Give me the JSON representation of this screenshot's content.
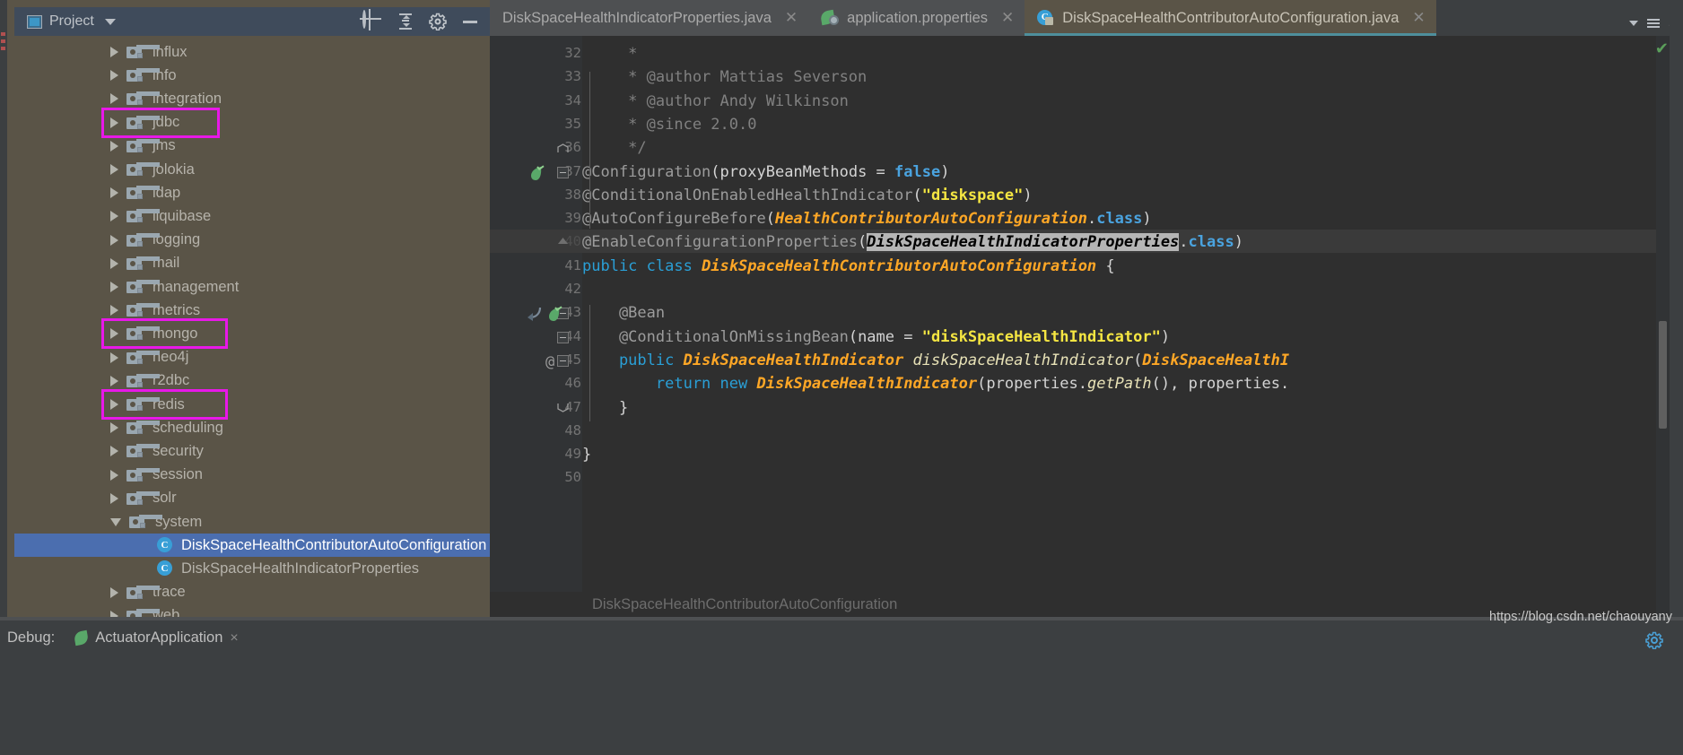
{
  "toolwindow": {
    "title": "Project",
    "icons": [
      "project-window-icon",
      "chevron-down-icon",
      "locate-target-icon",
      "collapse-all-icon",
      "settings-gear-icon",
      "hide-window-icon"
    ]
  },
  "tree": {
    "items": [
      {
        "label": "influx",
        "type": "folder",
        "state": "collapsed",
        "indent": 1,
        "highlight": false
      },
      {
        "label": "info",
        "type": "folder",
        "state": "collapsed",
        "indent": 1,
        "highlight": false
      },
      {
        "label": "integration",
        "type": "folder",
        "state": "collapsed",
        "indent": 1,
        "highlight": false
      },
      {
        "label": "jdbc",
        "type": "folder",
        "state": "collapsed",
        "indent": 1,
        "highlight": true
      },
      {
        "label": "jms",
        "type": "folder",
        "state": "collapsed",
        "indent": 1,
        "highlight": false
      },
      {
        "label": "jolokia",
        "type": "folder",
        "state": "collapsed",
        "indent": 1,
        "highlight": false
      },
      {
        "label": "ldap",
        "type": "folder",
        "state": "collapsed",
        "indent": 1,
        "highlight": false
      },
      {
        "label": "liquibase",
        "type": "folder",
        "state": "collapsed",
        "indent": 1,
        "highlight": false
      },
      {
        "label": "logging",
        "type": "folder",
        "state": "collapsed",
        "indent": 1,
        "highlight": false
      },
      {
        "label": "mail",
        "type": "folder",
        "state": "collapsed",
        "indent": 1,
        "highlight": false
      },
      {
        "label": "management",
        "type": "folder",
        "state": "collapsed",
        "indent": 1,
        "highlight": false
      },
      {
        "label": "metrics",
        "type": "folder",
        "state": "collapsed",
        "indent": 1,
        "highlight": false
      },
      {
        "label": "mongo",
        "type": "folder",
        "state": "collapsed",
        "indent": 1,
        "highlight": true
      },
      {
        "label": "neo4j",
        "type": "folder",
        "state": "collapsed",
        "indent": 1,
        "highlight": false
      },
      {
        "label": "r2dbc",
        "type": "folder",
        "state": "collapsed",
        "indent": 1,
        "highlight": false
      },
      {
        "label": "redis",
        "type": "folder",
        "state": "collapsed",
        "indent": 1,
        "highlight": true
      },
      {
        "label": "scheduling",
        "type": "folder",
        "state": "collapsed",
        "indent": 1,
        "highlight": false
      },
      {
        "label": "security",
        "type": "folder",
        "state": "collapsed",
        "indent": 1,
        "highlight": false
      },
      {
        "label": "session",
        "type": "folder",
        "state": "collapsed",
        "indent": 1,
        "highlight": false
      },
      {
        "label": "solr",
        "type": "folder",
        "state": "collapsed",
        "indent": 1,
        "highlight": false
      },
      {
        "label": "system",
        "type": "folder",
        "state": "expanded",
        "indent": 1,
        "highlight": false
      },
      {
        "label": "DiskSpaceHealthContributorAutoConfiguration",
        "type": "class",
        "state": "leaf",
        "indent": 3,
        "highlight": false,
        "selected": true,
        "icon_letter": "C"
      },
      {
        "label": "DiskSpaceHealthIndicatorProperties",
        "type": "class",
        "state": "leaf",
        "indent": 3,
        "highlight": false,
        "icon_letter": "C"
      },
      {
        "label": "trace",
        "type": "folder",
        "state": "collapsed",
        "indent": 1,
        "highlight": false
      },
      {
        "label": "web",
        "type": "folder",
        "state": "collapsed",
        "indent": 1,
        "highlight": false
      }
    ],
    "highlight_color": "#e818e8"
  },
  "tabs": [
    {
      "label": "DiskSpaceHealthIndicatorProperties.java",
      "icon": "java-class-icon",
      "active": false,
      "closable": true
    },
    {
      "label": "application.properties",
      "icon": "spring-properties-icon",
      "active": false,
      "closable": true
    },
    {
      "label": "DiskSpaceHealthContributorAutoConfiguration.java",
      "icon": "java-class-locked-icon",
      "active": true,
      "closable": true
    }
  ],
  "tabbar_right": {
    "count": "8"
  },
  "editor": {
    "lines": [
      {
        "num": "32",
        "segments": [
          {
            "t": "     * ",
            "c": "c-cmt"
          }
        ]
      },
      {
        "num": "33",
        "segments": [
          {
            "t": "     * @author Mattias Severson",
            "c": "c-cmt"
          }
        ]
      },
      {
        "num": "34",
        "segments": [
          {
            "t": "     * @author Andy Wilkinson",
            "c": "c-cmt"
          }
        ]
      },
      {
        "num": "35",
        "segments": [
          {
            "t": "     * @since 2.0.0",
            "c": "c-cmt"
          }
        ]
      },
      {
        "num": "36",
        "segments": [
          {
            "t": "     */",
            "c": "c-cmt"
          }
        ]
      },
      {
        "num": "37",
        "segments": [
          {
            "t": "@Configuration",
            "c": "c-anngrey"
          },
          {
            "t": "(",
            "c": "c-plain"
          },
          {
            "t": "proxyBeanMethods",
            "c": "c-plain"
          },
          {
            "t": " = ",
            "c": "c-plain"
          },
          {
            "t": "false",
            "c": "c-blue"
          },
          {
            "t": ")",
            "c": "c-plain"
          }
        ]
      },
      {
        "num": "38",
        "segments": [
          {
            "t": "@ConditionalOnEnabledHealthIndicator",
            "c": "c-anngrey"
          },
          {
            "t": "(",
            "c": "c-plain"
          },
          {
            "t": "\"diskspace\"",
            "c": "c-str"
          },
          {
            "t": ")",
            "c": "c-plain"
          }
        ]
      },
      {
        "num": "39",
        "segments": [
          {
            "t": "@AutoConfigureBefore",
            "c": "c-anngrey"
          },
          {
            "t": "(",
            "c": "c-plain"
          },
          {
            "t": "HealthContributorAutoConfiguration",
            "c": "c-cls"
          },
          {
            "t": ".",
            "c": "c-plain"
          },
          {
            "t": "class",
            "c": "c-blue"
          },
          {
            "t": ")",
            "c": "c-plain"
          }
        ]
      },
      {
        "num": "40",
        "highlighted": true,
        "segments": [
          {
            "t": "@EnableConfigurationProperties",
            "c": "c-anngrey"
          },
          {
            "t": "(",
            "c": "c-plain"
          },
          {
            "t": "DiskSpaceHealthIndicatorProperties",
            "c": "c-cls sel-span"
          },
          {
            "t": ".",
            "c": "c-plain"
          },
          {
            "t": "class",
            "c": "c-blue"
          },
          {
            "t": ")",
            "c": "c-plain"
          }
        ]
      },
      {
        "num": "41",
        "segments": [
          {
            "t": "public class ",
            "c": "c-kw"
          },
          {
            "t": "DiskSpaceHealthContributorAutoConfiguration",
            "c": "c-cls"
          },
          {
            "t": " {",
            "c": "c-plain"
          }
        ]
      },
      {
        "num": "42",
        "segments": []
      },
      {
        "num": "43",
        "segments": [
          {
            "t": "    @Bean",
            "c": "c-anngrey"
          }
        ]
      },
      {
        "num": "44",
        "segments": [
          {
            "t": "    @ConditionalOnMissingBean",
            "c": "c-anngrey"
          },
          {
            "t": "(",
            "c": "c-plain"
          },
          {
            "t": "name",
            "c": "c-plain"
          },
          {
            "t": " = ",
            "c": "c-plain"
          },
          {
            "t": "\"diskSpaceHealthIndicator\"",
            "c": "c-str"
          },
          {
            "t": ")",
            "c": "c-plain"
          }
        ]
      },
      {
        "num": "45",
        "segments": [
          {
            "t": "    public ",
            "c": "c-kw"
          },
          {
            "t": "DiskSpaceHealthIndicator",
            "c": "c-cls"
          },
          {
            "t": " ",
            "c": "c-plain"
          },
          {
            "t": "diskSpaceHealthIndicator",
            "c": "c-id"
          },
          {
            "t": "(",
            "c": "c-plain"
          },
          {
            "t": "DiskSpaceHealthI",
            "c": "c-cls"
          }
        ]
      },
      {
        "num": "46",
        "segments": [
          {
            "t": "        return new ",
            "c": "c-kw"
          },
          {
            "t": "DiskSpaceHealthIndicator",
            "c": "c-cls"
          },
          {
            "t": "(",
            "c": "c-plain"
          },
          {
            "t": "properties",
            "c": "c-plain"
          },
          {
            "t": ".",
            "c": "c-plain"
          },
          {
            "t": "getPath",
            "c": "c-id"
          },
          {
            "t": "(), ",
            "c": "c-plain"
          },
          {
            "t": "properties",
            "c": "c-plain"
          },
          {
            "t": ".",
            "c": "c-plain"
          }
        ]
      },
      {
        "num": "47",
        "segments": [
          {
            "t": "    }",
            "c": "c-plain"
          }
        ]
      },
      {
        "num": "48",
        "segments": []
      },
      {
        "num": "49",
        "segments": [
          {
            "t": "}",
            "c": "c-plain"
          }
        ]
      },
      {
        "num": "50",
        "segments": []
      }
    ],
    "gutter_icons": [
      {
        "line": "37",
        "icons": [
          "spring-bean-icon"
        ]
      },
      {
        "line": "43",
        "icons": [
          "override-arrow-icon",
          "spring-bean-icon"
        ]
      },
      {
        "line": "45",
        "icons": [
          "at-sign-icon"
        ]
      }
    ]
  },
  "breadcrumb": "DiskSpaceHealthContributorAutoConfiguration",
  "bottom": {
    "debug_label": "Debug:",
    "run_tab_label": "ActuatorApplication",
    "run_tab_close": "×"
  },
  "watermark": "https://blog.csdn.net/chaouyany",
  "colors": {
    "accent_selection": "#4b6eaf",
    "highlight_magenta": "#e818e8",
    "toolwindow_bg": "#5a5447",
    "editor_bg": "#2f2f2f",
    "tab_active_bg": "#5a5447"
  }
}
